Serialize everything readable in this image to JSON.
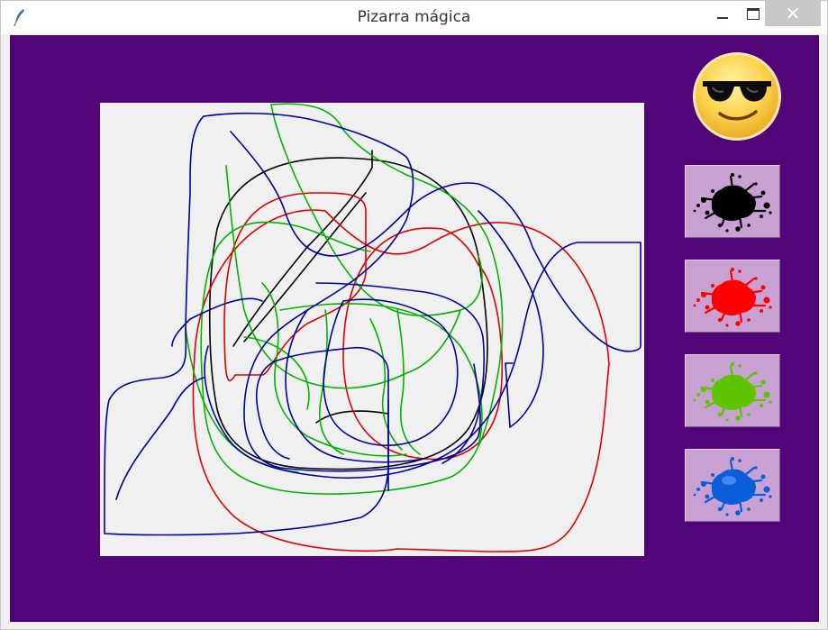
{
  "window": {
    "title": "Pizarra mágica",
    "close_glyph": "✕",
    "background_color": "#520578",
    "board_color": "#f0f0f0"
  },
  "status_icon": {
    "icon": "sunglasses-smiley-icon"
  },
  "palette": [
    {
      "name": "black",
      "color": "#000000",
      "icon": "black-ink-splat-icon"
    },
    {
      "name": "red",
      "color": "#ff0000",
      "icon": "red-ink-splat-icon"
    },
    {
      "name": "green",
      "color": "#5ec400",
      "icon": "green-ink-splat-icon"
    },
    {
      "name": "blue",
      "color": "#0a5fd8",
      "icon": "blue-ink-splat-icon"
    }
  ],
  "stroke_colors": {
    "black": "#000000",
    "red": "#e00000",
    "green": "#00b400",
    "blue": "#00009e"
  }
}
